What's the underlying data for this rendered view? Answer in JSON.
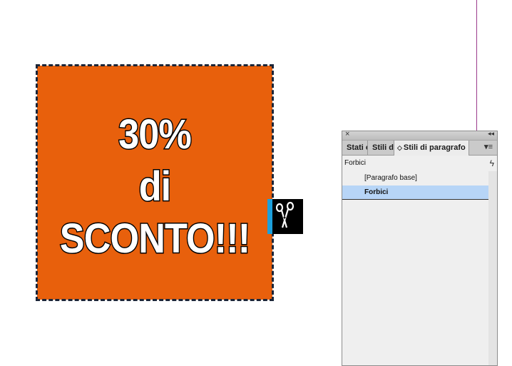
{
  "canvas": {
    "coupon": {
      "lines": [
        "30%",
        "di",
        "SCONTO!!!"
      ],
      "fill_color": "#e8600c",
      "frame_color": "#1b2538"
    },
    "cursor_icon": "scissors-icon",
    "accent_color": "#1da0dc",
    "guide_color": "#9b3a8c"
  },
  "panel": {
    "close_glyph": "×",
    "collapse_glyph": "◂◂",
    "tabs": [
      {
        "label": "Stati oggetto"
      },
      {
        "label": "Stili di carattere"
      },
      {
        "label": "Stili di paragrafo",
        "active": true
      }
    ],
    "tab_arrows_glyph": "◇",
    "menu_glyph": "▾≡",
    "current_style": "Forbici",
    "bolt_glyph": "ϟ",
    "items": [
      {
        "label": "[Paragrafo base]",
        "selected": false
      },
      {
        "label": "Forbici",
        "selected": true
      }
    ],
    "selected_color": "#b7d5f7"
  }
}
